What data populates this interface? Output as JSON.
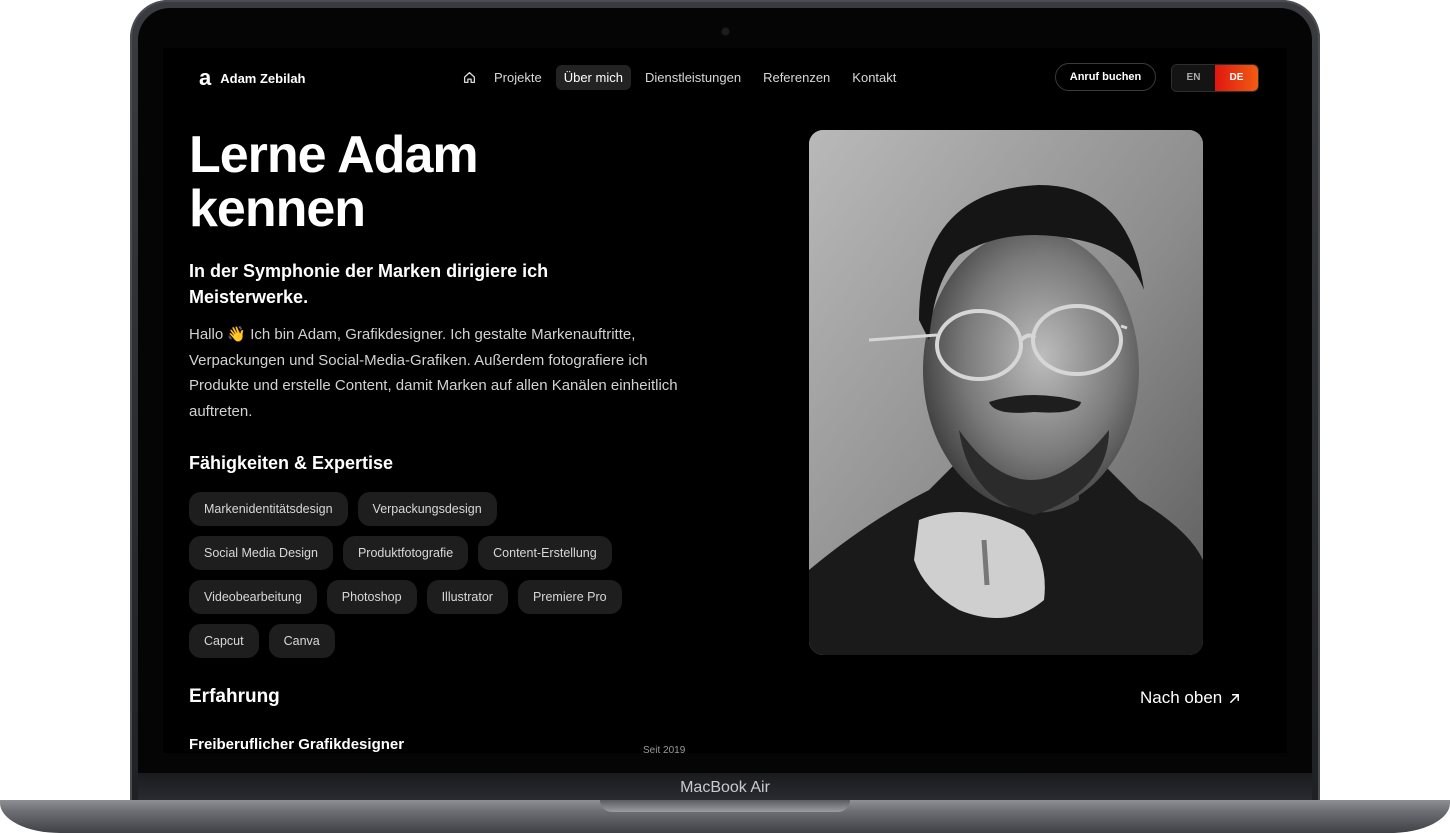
{
  "device": {
    "label": "MacBook Air"
  },
  "nav": {
    "brand_logo": "a",
    "brand_name": "Adam Zebilah",
    "home_icon": "home-icon",
    "items": [
      "Projekte",
      "Über mich",
      "Dienstleistungen",
      "Referenzen",
      "Kontakt"
    ],
    "active_item": "Über mich",
    "cta_label": "Anruf buchen",
    "languages": [
      "EN",
      "DE"
    ],
    "active_language": "DE"
  },
  "hero": {
    "title": "Lerne Adam kennen",
    "subtitle": "In der Symphonie der Marken dirigiere ich Meisterwerke.",
    "intro": "Hallo 👋 Ich bin Adam, Grafikdesigner. Ich gestalte Markenauftritte, Verpackungen und Social-Media-Grafiken. Außerdem fotografiere ich Produkte und erstelle Content, damit Marken auf allen Kanälen einheitlich auftreten."
  },
  "skills": {
    "heading": "Fähigkeiten & Expertise",
    "rows": [
      [
        "Markenidentitätsdesign",
        "Verpackungsdesign"
      ],
      [
        "Social Media Design",
        "Produktfotografie",
        "Content-Erstellung"
      ],
      [
        "Videobearbeitung",
        "Photoshop",
        "Illustrator",
        "Premiere Pro"
      ],
      [
        "Capcut",
        "Canva"
      ]
    ]
  },
  "experience": {
    "heading": "Erfahrung",
    "back_to_top": "Nach oben",
    "back_to_top_icon": "arrow-up-right-icon",
    "first_job_title": "Freiberuflicher Grafikdesigner",
    "first_job_date": "Seit 2019"
  },
  "colors": {
    "background": "#000000",
    "tag_background": "#1e1e1e",
    "accent_gradient_start": "#e0170f",
    "accent_gradient_end": "#f25c12"
  }
}
